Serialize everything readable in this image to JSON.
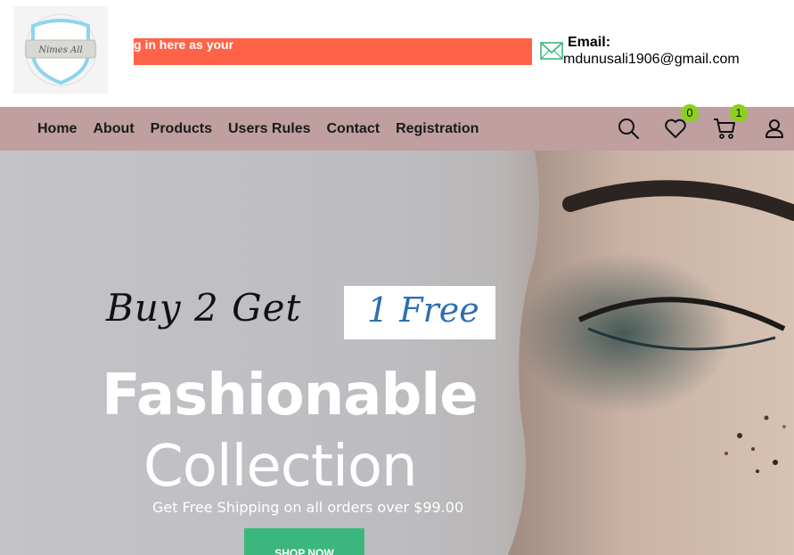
{
  "header": {
    "logo_icon": "crest-logo-icon",
    "logo_text": "Nimes All",
    "marquee_text": "g in here as your",
    "email_label": "Email:",
    "email_value": "mdunusali1906@gmail.com",
    "mail_icon": "envelope-icon"
  },
  "nav": {
    "links": [
      "Home",
      "About",
      "Products",
      "Users Rules",
      "Contact",
      "Registration"
    ],
    "icons": {
      "search": "search-icon",
      "wishlist": "heart-icon",
      "cart": "cart-icon",
      "account": "user-icon"
    },
    "wishlist_count": "0",
    "cart_count": "1"
  },
  "hero": {
    "promo_prefix": "Buy 2 Get",
    "promo_highlight": "1 Free",
    "title_line1": "Fashionable",
    "title_line2": "Collection",
    "subtitle": "Get Free Shipping on all orders over $99.00",
    "cta_label": "SHOP NOW"
  },
  "colors": {
    "marquee_bg": "#ff6347",
    "nav_bg": "#bf9f9f",
    "badge": "#8bd11c",
    "cta_bg": "#3bb77e",
    "promo_highlight": "#2f6fb2"
  }
}
